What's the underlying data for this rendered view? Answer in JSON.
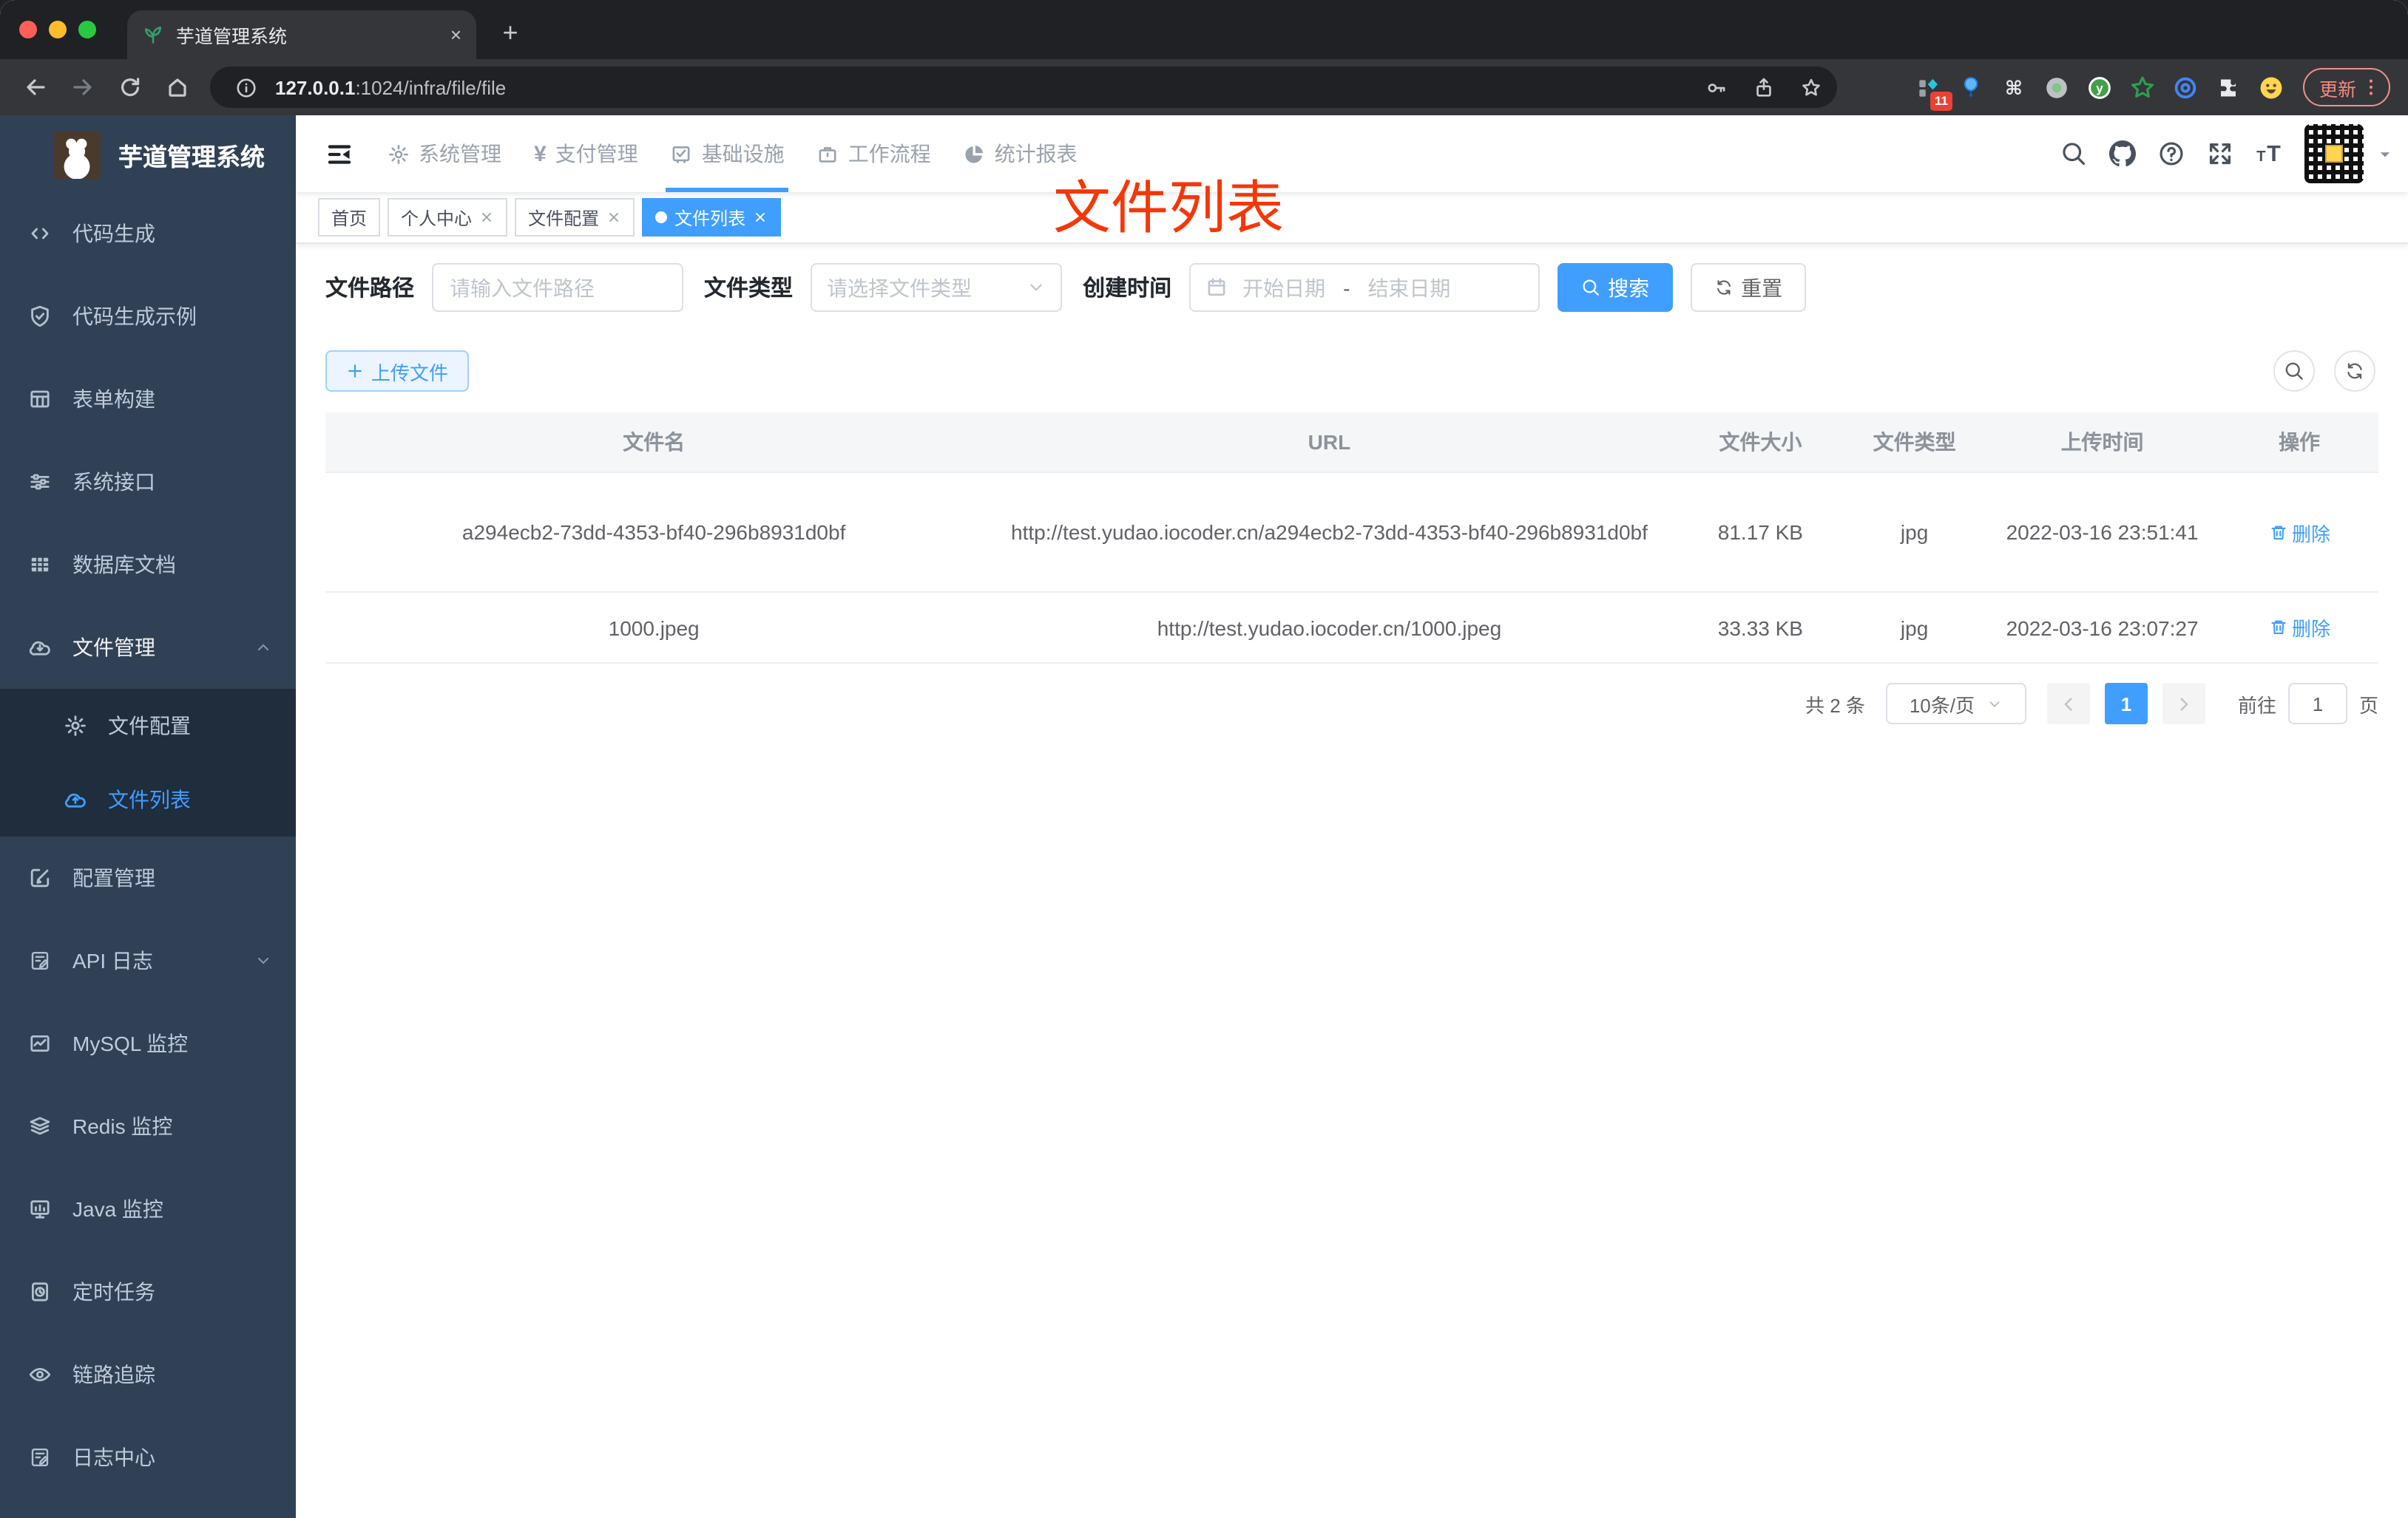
{
  "browser": {
    "tab_title": "芋道管理系统",
    "tab_close": "×",
    "new_tab_plus": "+",
    "url_host": "127.0.0.1",
    "url_rest": ":1024/infra/file/file",
    "extensions_badge": "11",
    "update_label": "更新",
    "toolbar_icons": [
      "back-icon",
      "forward-icon",
      "reload-icon",
      "home-icon"
    ],
    "omnibox_icons": [
      "info-icon",
      "key-icon",
      "share-icon",
      "bookmark-star-icon"
    ],
    "extension_icons": [
      "extensions-badge-icon",
      "balloon-icon",
      "command-icon",
      "record-icon",
      "y-logo-icon",
      "green-star-icon",
      "blue-eye-icon",
      "puzzle-icon",
      "emoji-icon"
    ],
    "menu_icon": "kebab-menu-icon"
  },
  "sidebar": {
    "logo_title": "芋道管理系统",
    "items": [
      {
        "label": "代码生成",
        "icon": "code-icon"
      },
      {
        "label": "代码生成示例",
        "icon": "shield-check-icon"
      },
      {
        "label": "表单构建",
        "icon": "form-table-icon"
      },
      {
        "label": "系统接口",
        "icon": "sliders-icon"
      },
      {
        "label": "数据库文档",
        "icon": "db-table-icon"
      },
      {
        "label": "文件管理",
        "icon": "cloud-download-icon",
        "expanded": true
      },
      {
        "label": "文件配置",
        "icon": "gear-icon",
        "sub": true
      },
      {
        "label": "文件列表",
        "icon": "cloud-upload-icon",
        "sub": true,
        "active": true
      },
      {
        "label": "配置管理",
        "icon": "edit-square-icon"
      },
      {
        "label": "API 日志",
        "icon": "log-edit-icon",
        "collapsed": true
      },
      {
        "label": "MySQL 监控",
        "icon": "line-chart-icon"
      },
      {
        "label": "Redis 监控",
        "icon": "layers-icon"
      },
      {
        "label": "Java 监控",
        "icon": "monitor-icon"
      },
      {
        "label": "定时任务",
        "icon": "schedule-icon"
      },
      {
        "label": "链路追踪",
        "icon": "eye-icon"
      },
      {
        "label": "日志中心",
        "icon": "log-edit-icon"
      }
    ]
  },
  "topnav": {
    "tabs": [
      {
        "label": "系统管理",
        "icon": "gear-icon"
      },
      {
        "label": "支付管理",
        "icon": "yen-icon"
      },
      {
        "label": "基础设施",
        "icon": "infra-check-icon",
        "active": true
      },
      {
        "label": "工作流程",
        "icon": "briefcase-icon"
      },
      {
        "label": "统计报表",
        "icon": "pie-chart-icon"
      }
    ],
    "right_icons": [
      "search-icon",
      "github-icon",
      "help-icon",
      "fullscreen-icon",
      "font-size-icon",
      "qr-avatar",
      "caret-down-icon"
    ]
  },
  "tags": [
    {
      "label": "首页"
    },
    {
      "label": "个人中心",
      "closable": true
    },
    {
      "label": "文件配置",
      "closable": true
    },
    {
      "label": "文件列表",
      "closable": true,
      "active": true
    }
  ],
  "annotation": {
    "text": "文件列表"
  },
  "filters": {
    "path_label": "文件路径",
    "path_placeholder": "请输入文件路径",
    "type_label": "文件类型",
    "type_placeholder": "请选择文件类型",
    "date_label": "创建时间",
    "date_start_placeholder": "开始日期",
    "date_separator": "-",
    "date_end_placeholder": "结束日期",
    "search_label": "搜索",
    "reset_label": "重置"
  },
  "toolbar": {
    "upload_label": "上传文件",
    "icons": [
      "search-icon",
      "refresh-icon"
    ]
  },
  "table": {
    "columns": [
      "文件名",
      "URL",
      "文件大小",
      "文件类型",
      "上传时间",
      "操作"
    ],
    "rows": [
      {
        "name": "a294ecb2-73dd-4353-bf40-296b8931d0bf",
        "url": "http://test.yudao.iocoder.cn/a294ecb2-73dd-4353-bf40-296b8931d0bf",
        "size": "81.17 KB",
        "type": "jpg",
        "time": "2022-03-16 23:51:41",
        "action": "删除"
      },
      {
        "name": "1000.jpeg",
        "url": "http://test.yudao.iocoder.cn/1000.jpeg",
        "size": "33.33 KB",
        "type": "jpg",
        "time": "2022-03-16 23:07:27",
        "action": "删除"
      }
    ]
  },
  "pagination": {
    "total": "共 2 条",
    "page_size": "10条/页",
    "current_page": "1",
    "goto_label": "前往",
    "goto_value": "1",
    "page_unit": "页"
  },
  "colors": {
    "accent": "#409eff",
    "sidebar_bg": "#304156",
    "submenu_bg": "#1f2d3d",
    "annotation": "#f53708",
    "active_tag_bg": "#409eff"
  }
}
